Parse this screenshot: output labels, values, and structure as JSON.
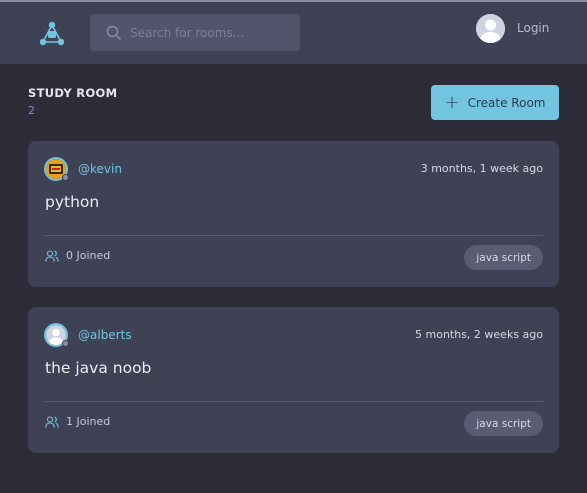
{
  "header": {
    "search_placeholder": "Search for rooms...",
    "login_label": "Login"
  },
  "main": {
    "heading": "STUDY ROOM",
    "room_count": "2",
    "create_button_label": "Create Room"
  },
  "rooms": [
    {
      "host": "@kevin",
      "time_ago": "3 months, 1 week ago",
      "title": "python",
      "joined": "0 Joined",
      "topic": "java script"
    },
    {
      "host": "@alberts",
      "time_ago": "5 months, 2 weeks ago",
      "title": "the java noob",
      "joined": "1 Joined",
      "topic": "java script"
    }
  ],
  "colors": {
    "accent": "#71c5e0",
    "background": "#2d2d39",
    "panel": "#3f4155"
  }
}
